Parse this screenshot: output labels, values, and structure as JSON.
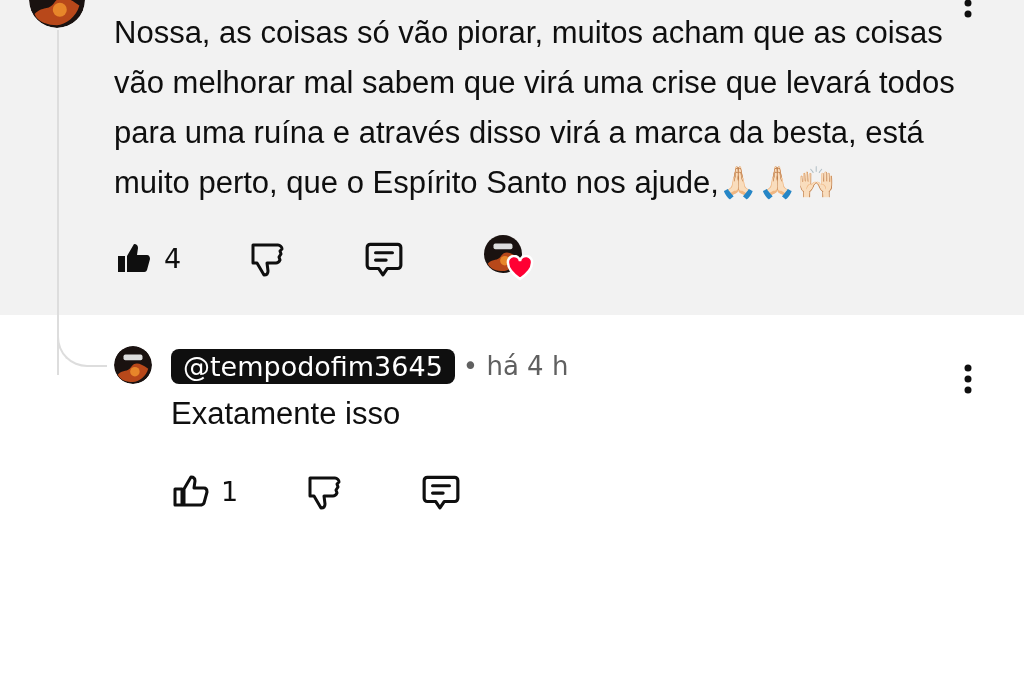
{
  "comments": [
    {
      "text": "Nossa, as coisas só vão piorar, muitos acham que as coisas vão melhorar mal sabem que virá uma crise que levará todos para uma ruína e através disso virá a marca da besta, está muito perto, que o Espírito Santo  nos ajude,🙏🏻🙏🏻🙌🏻",
      "likes": "4",
      "liked": true,
      "creator_hearted": true,
      "highlighted": true
    },
    {
      "author": "@tempodofim3645",
      "author_is_creator": true,
      "time": "• há 4 h",
      "text": "Exatamente isso",
      "likes": "1",
      "liked": false,
      "creator_hearted": false,
      "highlighted": false
    }
  ]
}
